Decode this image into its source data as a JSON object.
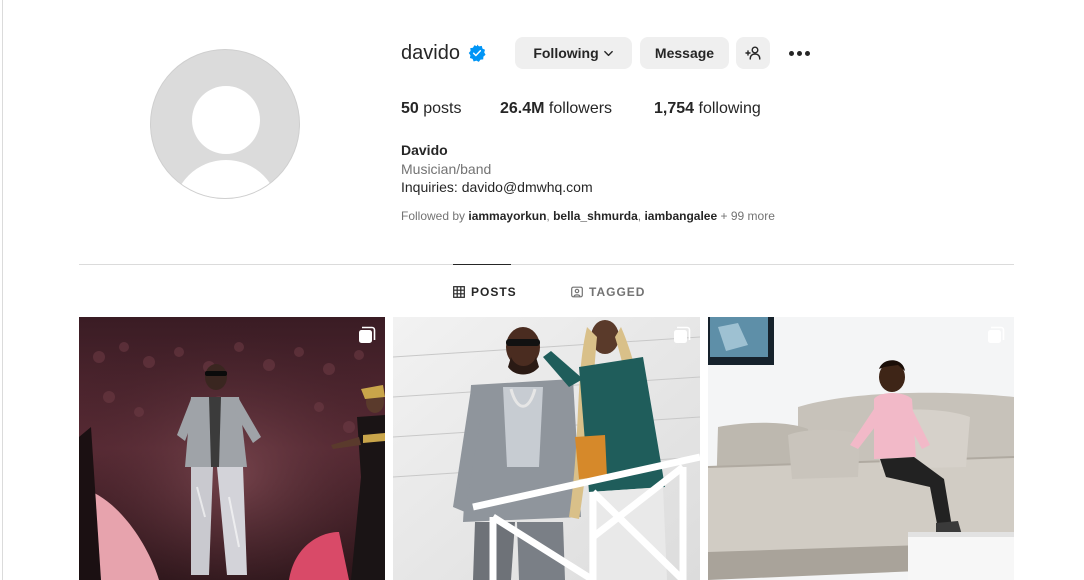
{
  "profile": {
    "username": "davido",
    "verified": true,
    "display_name": "Davido",
    "category": "Musician/band",
    "bio": "Inquiries: davido@dmwhq.com",
    "avatar_icon": "default-avatar-icon"
  },
  "actions": {
    "following_label": "Following",
    "message_label": "Message",
    "suggest_icon": "add-person-icon",
    "more_icon": "more-options-icon"
  },
  "stats": {
    "posts_count": "50",
    "posts_label": "posts",
    "followers_count": "26.4M",
    "followers_label": "followers",
    "following_count": "1,754",
    "following_label": "following"
  },
  "followed_by": {
    "prefix": "Followed by",
    "users": [
      "iammayorkun",
      "bella_shmurda",
      "iambangalee"
    ],
    "more": "+ 99 more"
  },
  "tabs": [
    {
      "label": "POSTS",
      "icon": "grid-icon",
      "active": true
    },
    {
      "label": "TAGGED",
      "icon": "tagged-icon",
      "active": false
    }
  ],
  "posts": [
    {
      "type": "carousel",
      "icon": "multiple-posts-icon"
    },
    {
      "type": "carousel",
      "icon": "multiple-posts-icon"
    },
    {
      "type": "carousel",
      "icon": "multiple-posts-icon"
    }
  ],
  "colors": {
    "verified_blue": "#0095f6",
    "button_bg": "#efefef",
    "text_primary": "#262626",
    "text_secondary": "#737373",
    "divider": "#dbdbdb"
  }
}
